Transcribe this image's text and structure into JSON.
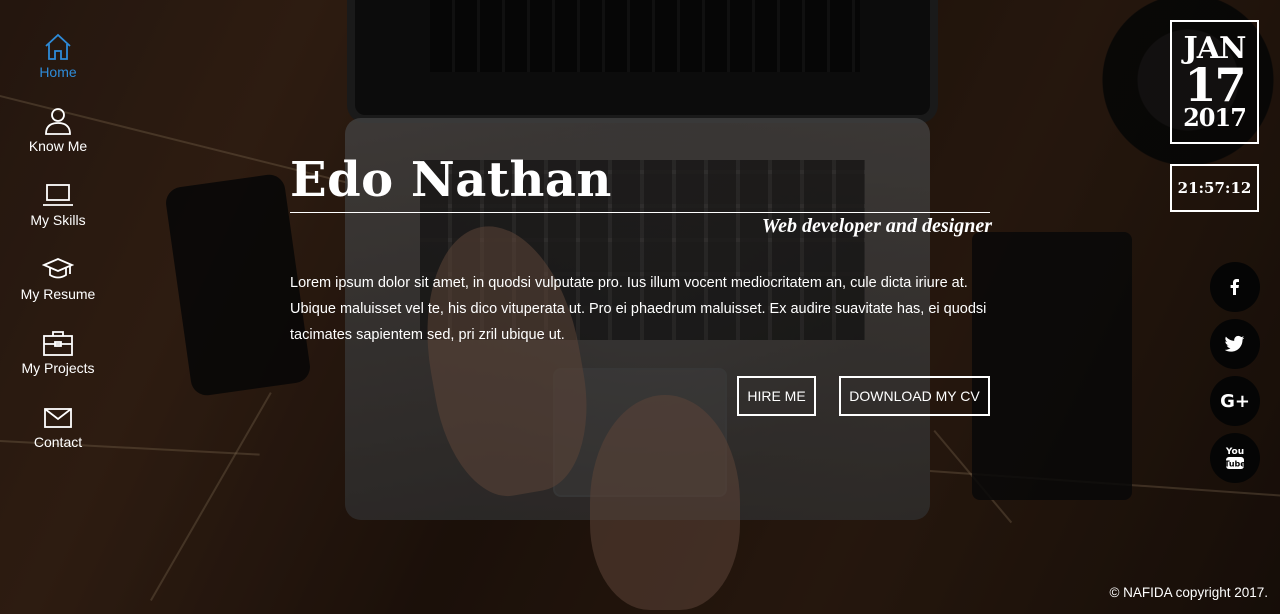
{
  "nav": {
    "items": [
      {
        "label": "Home",
        "icon": "home-icon",
        "active": true
      },
      {
        "label": "Know Me",
        "icon": "user-icon"
      },
      {
        "label": "My Skills",
        "icon": "laptop-icon"
      },
      {
        "label": "My Resume",
        "icon": "graduation-cap-icon"
      },
      {
        "label": "My Projects",
        "icon": "briefcase-icon"
      },
      {
        "label": "Contact",
        "icon": "envelope-icon"
      }
    ],
    "active_color": "#2e8bd8"
  },
  "hero": {
    "name": "Edo Nathan",
    "subtitle": "Web developer and designer",
    "text": "Lorem ipsum dolor sit amet, in quodsi vulputate pro. Ius illum vocent mediocritatem an, cule dicta iriure at. Ubique maluisset vel te, his dico vituperata ut. Pro ei phaedrum maluisset. Ex audire suavitate has, ei quodsi tacimates sapientem sed, pri zril ubique ut.",
    "hire_label": "HIRE ME",
    "cv_label": "DOWNLOAD MY CV"
  },
  "date": {
    "month": "JAN",
    "day": "17",
    "year": "2017"
  },
  "time": "21:57:12",
  "social": [
    {
      "icon": "facebook-icon",
      "glyph": "f"
    },
    {
      "icon": "twitter-icon",
      "glyph": "🐦"
    },
    {
      "icon": "google-plus-icon",
      "glyph": "G+"
    },
    {
      "icon": "youtube-icon",
      "glyph": "You Tube"
    }
  ],
  "footer": {
    "copyright": "© NAFIDA copyright 2017."
  }
}
